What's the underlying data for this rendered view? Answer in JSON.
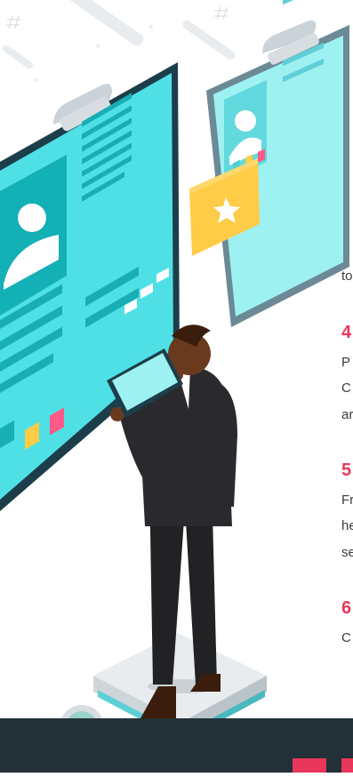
{
  "colors": {
    "accent": "#e8375a",
    "panel_cyan": "#4fe0e6",
    "panel_light": "#9ef1f1",
    "frame_dark": "#1c3e4a",
    "frame_grey": "#6b8a96",
    "star_card": "#ffcc47",
    "footer": "#243038"
  },
  "steps": [
    {
      "number": "4",
      "lines": [
        "P",
        "C",
        "ar"
      ]
    },
    {
      "number": "5",
      "lines": [
        "Fr",
        "he",
        "se"
      ]
    },
    {
      "number": "6",
      "lines": [
        "C"
      ]
    }
  ],
  "prior_tail": "to",
  "icons": [
    "clipboard-left-icon",
    "clipboard-right-icon",
    "user-avatar-icon",
    "star-icon",
    "tablet-icon",
    "magnifier-icon",
    "hash-icon"
  ]
}
